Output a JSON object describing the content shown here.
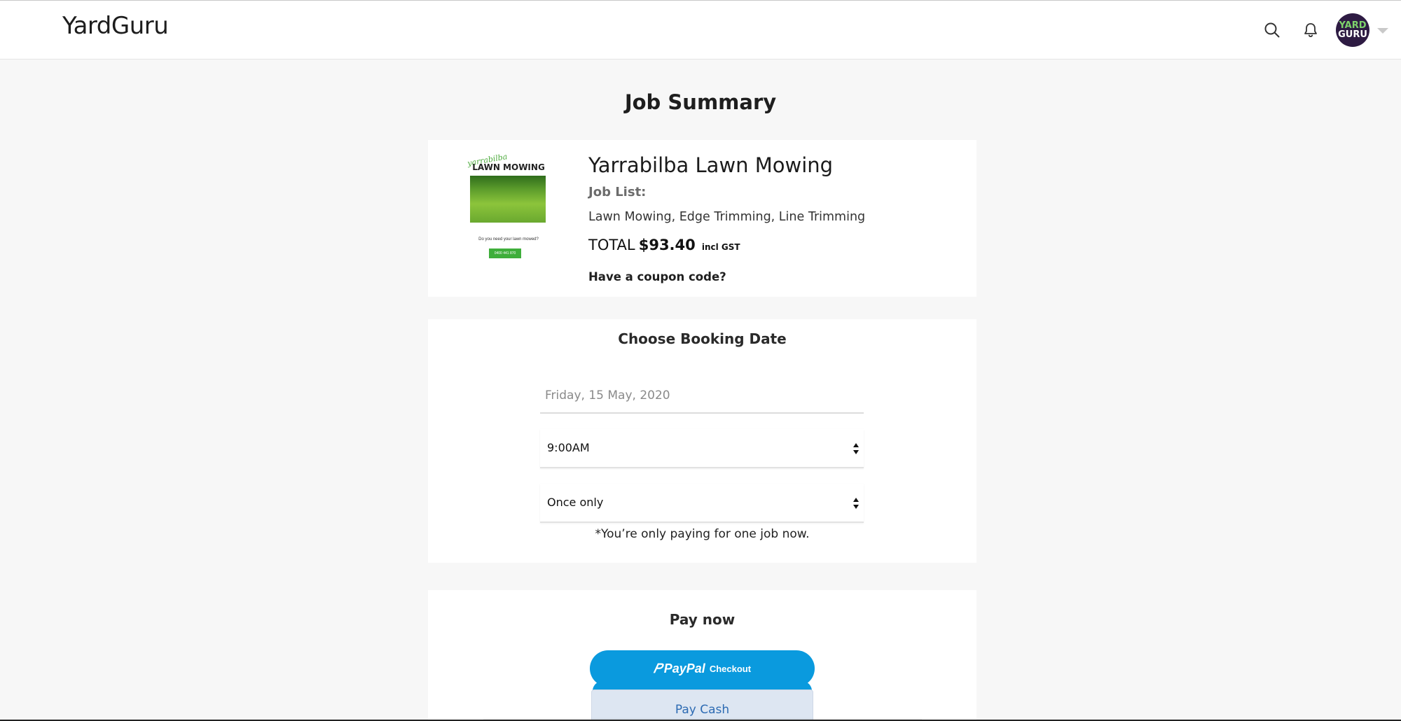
{
  "header": {
    "brand": "YardGuru",
    "icons": [
      "search-icon",
      "bell-icon"
    ],
    "avatar": {
      "line1": "YARD",
      "line2": "GURU"
    }
  },
  "page": {
    "title": "Job Summary"
  },
  "summary": {
    "thumbnail": {
      "script_text": "yarrabilba",
      "heading": "LAWN MOWING",
      "question": "Do you need your lawn mowed?",
      "phone": "0400 441 870"
    },
    "business_name": "Yarrabilba Lawn Mowing",
    "job_list_label": "Job List:",
    "job_list": "Lawn Mowing, Edge Trimming, Line Trimming",
    "total_label": "TOTAL",
    "total_amount": "$93.40",
    "total_suffix": "incl GST",
    "coupon_link": "Have a coupon code?"
  },
  "booking": {
    "title": "Choose Booking Date",
    "date_value": "Friday, 15 May, 2020",
    "time_value": "9:00AM",
    "frequency_value": "Once only",
    "note": "*You’re only paying for one job now."
  },
  "payment": {
    "title": "Pay now",
    "paypal_logo": "PayPal",
    "paypal_label": "Checkout",
    "cash_label": "Pay Cash"
  },
  "colors": {
    "brand_dark": "#2e1b43",
    "brand_green": "#7dd36b",
    "paypal_blue": "#0a9ade",
    "cash_text": "#2d6bb3"
  }
}
